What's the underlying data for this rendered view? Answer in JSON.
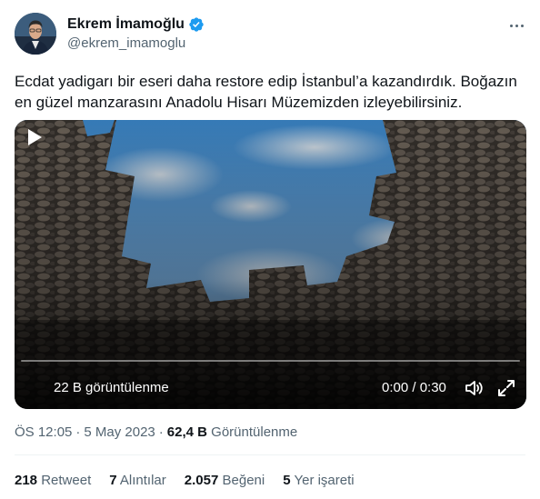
{
  "author": {
    "name": "Ekrem İmamoğlu",
    "handle": "@ekrem_imamoglu",
    "verified": true,
    "verified_color": "#1d9bf0",
    "avatar_icon": "profile-photo"
  },
  "more_icon": "more-horizontal-icon",
  "tweet": {
    "text": "Ecdat yadigarı bir eseri daha restore edip İstanbul’a kazandırdık. Boğazın en güzel manzarasını Anadolu Hisarı Müzemizden izleyebilirsiniz."
  },
  "video": {
    "views": "22 B görüntülenme",
    "time": "0:00 / 0:30",
    "progress": 0.0,
    "play_icon": "play-icon",
    "volume_icon": "volume-icon",
    "fullscreen_icon": "fullscreen-icon"
  },
  "meta": {
    "time": "ÖS 12:05",
    "date": "5 May 2023",
    "view_count": "62,4 B",
    "view_label": "Görüntülenme"
  },
  "stats": {
    "retweets_count": "218",
    "retweets_label": "Retweet",
    "quotes_count": "7",
    "quotes_label": "Alıntılar",
    "likes_count": "2.057",
    "likes_label": "Beğeni",
    "bookmarks_count": "5",
    "bookmarks_label": "Yer işareti"
  },
  "colors": {
    "text_primary": "#0f1419",
    "text_secondary": "#536471",
    "accent": "#1d9bf0"
  }
}
